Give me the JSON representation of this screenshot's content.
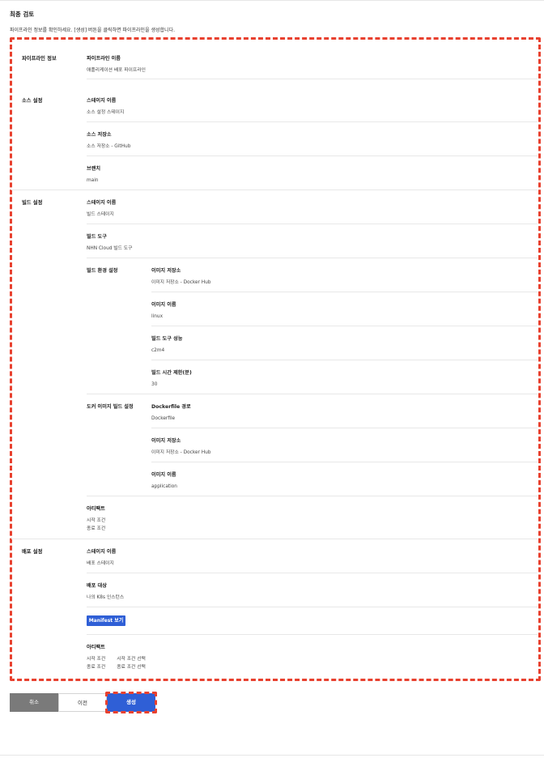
{
  "page": {
    "title": "최종 검토",
    "description": "파이프라인 정보를 확인하세요. [생성] 버튼을 클릭하면 파이프라인을 생성합니다."
  },
  "pipeline_info": {
    "title": "파이프라인 정보",
    "name_label": "파이프라인 이름",
    "name_value": "애플리케이션 배포 파이프라인"
  },
  "source": {
    "title": "소스 설정",
    "stage_label": "스테이지 이름",
    "stage_value": "소스 설정 스테이지",
    "repo_label": "소스 저장소",
    "repo_value": "소스 저장소 - GitHub",
    "branch_label": "브랜치",
    "branch_value": "main"
  },
  "build": {
    "title": "빌드 설정",
    "stage_label": "스테이지 이름",
    "stage_value": "빌드 스테이지",
    "tool_label": "빌드 도구",
    "tool_value": "NHN Cloud 빌드 도구",
    "env": {
      "title": "빌드 환경 설정",
      "image_repo_label": "이미지 저장소",
      "image_repo_value": "이미지 저장소 - Docker Hub",
      "image_name_label": "이미지 이름",
      "image_name_value": "linux",
      "perf_label": "빌드 도구 성능",
      "perf_value": "c2m4",
      "timeout_label": "빌드 시간 제한(분)",
      "timeout_value": "30"
    },
    "docker": {
      "title": "도커 이미지 빌드 설정",
      "dockerfile_label": "Dockerfile 경로",
      "dockerfile_value": "Dockerfile",
      "image_repo_label": "이미지 저장소",
      "image_repo_value": "이미지 저장소 - Docker Hub",
      "image_name_label": "이미지 이름",
      "image_name_value": "application"
    },
    "artifact": {
      "label": "아티팩트",
      "start": "시작 조건",
      "end": "종료 조건"
    }
  },
  "deploy": {
    "title": "배포 설정",
    "stage_label": "스테이지 이름",
    "stage_value": "배포 스테이지",
    "target_label": "배포 대상",
    "target_value": "나의 K8s 인스턴스",
    "manifest_button": "Manifest 보기",
    "artifact": {
      "label": "아티팩트",
      "start_key": "시작 조건",
      "start_value": "시작 조건 선택",
      "end_key": "종료 조건",
      "end_value": "종료 조건 선택"
    }
  },
  "actions": {
    "cancel": "취소",
    "prev": "이전",
    "create": "생성"
  },
  "colors": {
    "primary": "#2f5fd6",
    "cancel": "#7a7a7a",
    "highlight": "#e8412f"
  }
}
